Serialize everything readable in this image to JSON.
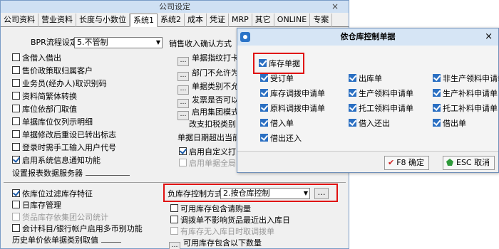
{
  "window": {
    "title": "公司设定",
    "close": "×"
  },
  "tabs": [
    "公司资料",
    "营业资料",
    "长度与小数位",
    "系统1",
    "系统2",
    "成本",
    "凭证",
    "MRP",
    "其它",
    "ONLINE",
    "专案"
  ],
  "left": {
    "bpr_label": "BPR流程设定",
    "bpr_value": "5.不管制",
    "items": [
      {
        "label": "含借入借出",
        "checked": false
      },
      {
        "label": "售价政策取归属客户",
        "checked": false
      },
      {
        "label": "业务员(经办人)取识别码",
        "checked": false
      },
      {
        "label": "资料简繁体转换",
        "checked": false
      },
      {
        "label": "库位依部门取值",
        "checked": false
      },
      {
        "label": "单据库位仅列示明细",
        "checked": false
      },
      {
        "label": "单据修改后重设已转出标志",
        "checked": false
      },
      {
        "label": "登录时需手工输入用户代号",
        "checked": false
      },
      {
        "label": "启用系统信息通知功能",
        "checked": true
      }
    ],
    "server_label": "设置报表数据服务器"
  },
  "middle": {
    "sales_label": "销售收入确认方式",
    "items": [
      "单据指纹打卡",
      "部门不允许为",
      "单据类别不允",
      "发票是否可以",
      "启用集团模式"
    ],
    "text1": "改支扣税类别",
    "text2": "单据日期超出当前",
    "custom": "启用自定义打",
    "custom2": "启用单据全局"
  },
  "bottom": {
    "left_items": [
      {
        "label": "依库位过滤库存特征",
        "checked": true,
        "disabled": false
      },
      {
        "label": "日库存管理",
        "checked": false,
        "disabled": false
      },
      {
        "label": "货品库存依集团公司统计",
        "checked": false,
        "disabled": true
      },
      {
        "label": "会计科目/银行帐户启用多币别功能",
        "checked": false,
        "disabled": false
      }
    ],
    "hist_label": "历史单价依单据类别取值",
    "neg_label": "负库存控制方式",
    "neg_value": "2.按仓库控制",
    "right_items": [
      {
        "label": "可用库存包含请购量",
        "checked": false,
        "disabled": false
      },
      {
        "label": "调拨单不影响货品最近出入库日",
        "checked": false,
        "disabled": false
      },
      {
        "label": "有库存无入库日时取调拨单",
        "checked": false,
        "disabled": true
      }
    ],
    "below_label": "可用库存包含以下数量"
  },
  "dialog": {
    "title": "依仓库控制单据",
    "close": "×",
    "master": {
      "label": "库存单据",
      "checked": true
    },
    "col1": [
      "受订单",
      "库存调拨申请单",
      "原料调拨申请单",
      "借入单",
      "借出还入"
    ],
    "col2": [
      "出库单",
      "生产领料申请单",
      "托工领料申请单",
      "借入还出"
    ],
    "col3": [
      "非生产领料申请单",
      "生产补料申请单",
      "托工补料申请单",
      "借出单"
    ],
    "ok_label": "F8 确定",
    "cancel_label": "ESC 取消"
  }
}
